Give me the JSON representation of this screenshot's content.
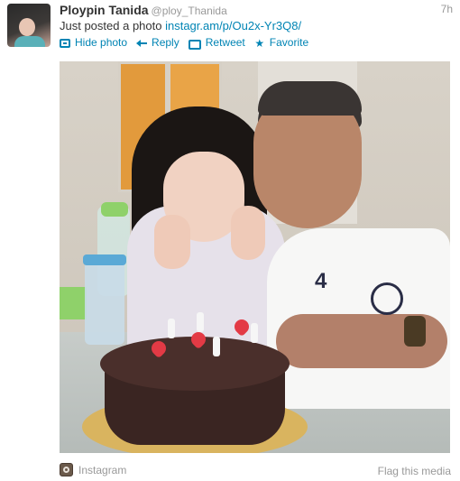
{
  "tweet": {
    "author_name": "Ploypin Tanida",
    "author_handle": "@ploy_Thanida",
    "time": "7h",
    "text": "Just posted a photo ",
    "link": "instagr.am/p/Ou2x-Yr3Q8/"
  },
  "actions": {
    "hide_photo": "Hide photo",
    "reply": "Reply",
    "retweet": "Retweet",
    "favorite": "Favorite"
  },
  "icons": {
    "hide_photo": "photo-icon",
    "reply": "reply-icon",
    "retweet": "retweet-icon",
    "favorite": "star-icon",
    "source": "instagram-icon"
  },
  "footer": {
    "source": "Instagram",
    "flag": "Flag this media"
  },
  "colors": {
    "link": "#0084b4",
    "text": "#333333",
    "muted": "#999999"
  }
}
